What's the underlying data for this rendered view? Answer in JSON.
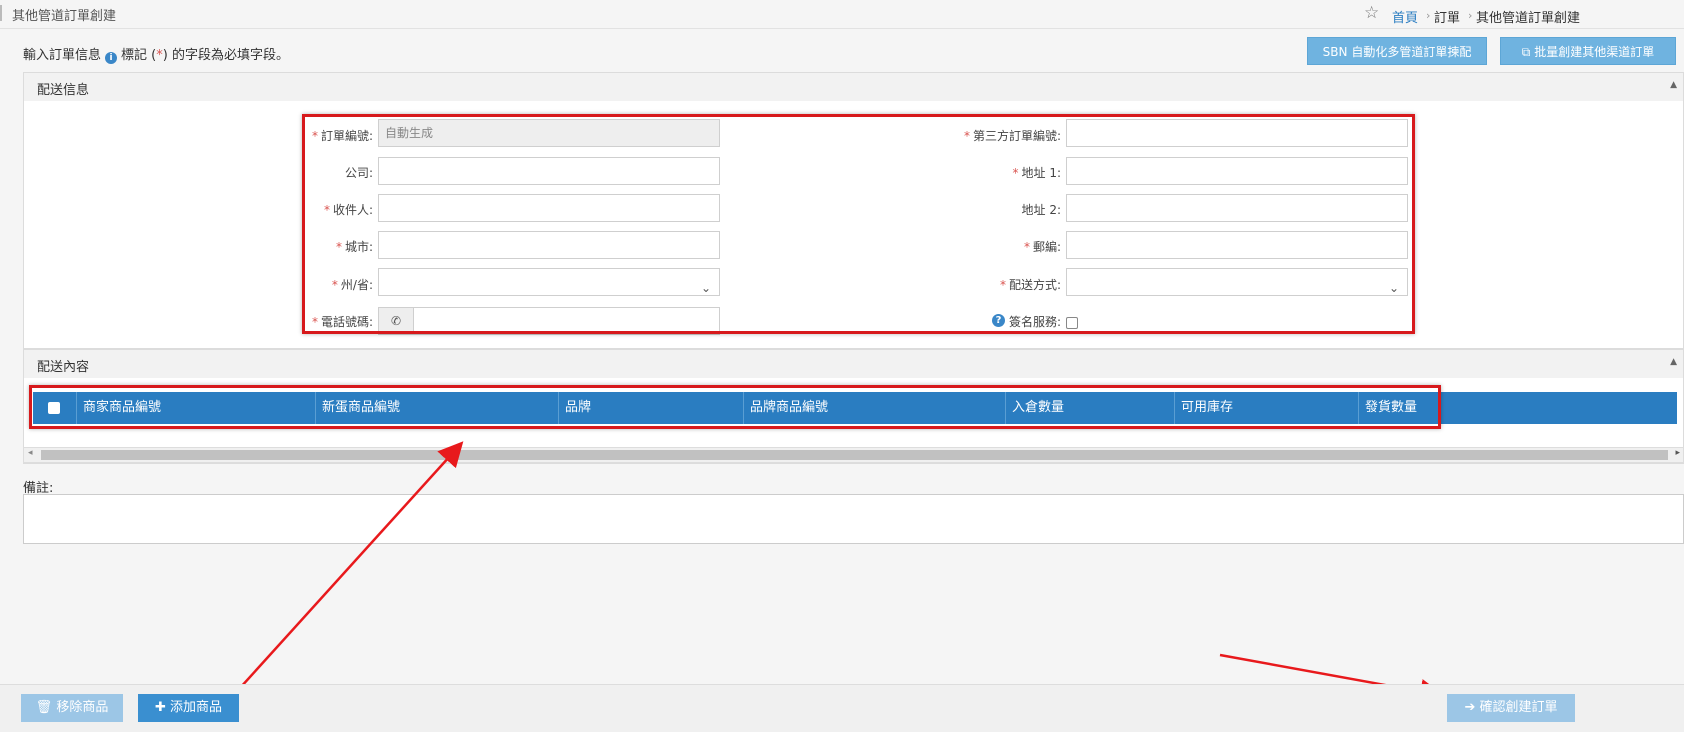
{
  "header": {
    "title": "其他管道訂單創建",
    "breadcrumb": [
      "首頁",
      "訂單",
      "其他管道訂單創建"
    ]
  },
  "info": {
    "prefix": "輸入訂單信息",
    "middle": "標記 (",
    "mark": "*",
    "suffix": ") 的字段為必填字段。"
  },
  "top_buttons": {
    "sbn": "SBN 自動化多管道訂單揀配",
    "batch": "批量創建其他渠道訂單"
  },
  "shipping_info": {
    "section_title": "配送信息",
    "fields_left": [
      {
        "label": "訂單編號:",
        "required": true,
        "value": "自動生成"
      },
      {
        "label": "公司:",
        "required": false,
        "value": ""
      },
      {
        "label": "收件人:",
        "required": true,
        "value": ""
      },
      {
        "label": "城市:",
        "required": true,
        "value": ""
      },
      {
        "label": "州/省:",
        "required": true,
        "value": ""
      },
      {
        "label": "電話號碼:",
        "required": true,
        "value": ""
      }
    ],
    "fields_right": [
      {
        "label": "第三方訂單編號:",
        "required": true,
        "value": ""
      },
      {
        "label": "地址 1:",
        "required": true,
        "value": ""
      },
      {
        "label": "地址 2:",
        "required": false,
        "value": ""
      },
      {
        "label": "郵編:",
        "required": true,
        "value": ""
      },
      {
        "label": "配送方式:",
        "required": true,
        "value": ""
      },
      {
        "label": "簽名服務:",
        "required": false,
        "value": ""
      }
    ]
  },
  "shipping_content": {
    "section_title": "配送內容",
    "columns": [
      "商家商品編號",
      "新蛋商品編號",
      "品牌",
      "品牌商品編號",
      "入倉數量",
      "可用庫存",
      "發貨數量"
    ]
  },
  "remarks": {
    "label": "備註:"
  },
  "bottom_buttons": {
    "remove": "移除商品",
    "add": "添加商品",
    "confirm": "確認創建訂單"
  },
  "colors": {
    "primary": "#2a7dc1",
    "button_light": "#6fb3e0",
    "annotation": "#d7191c"
  }
}
